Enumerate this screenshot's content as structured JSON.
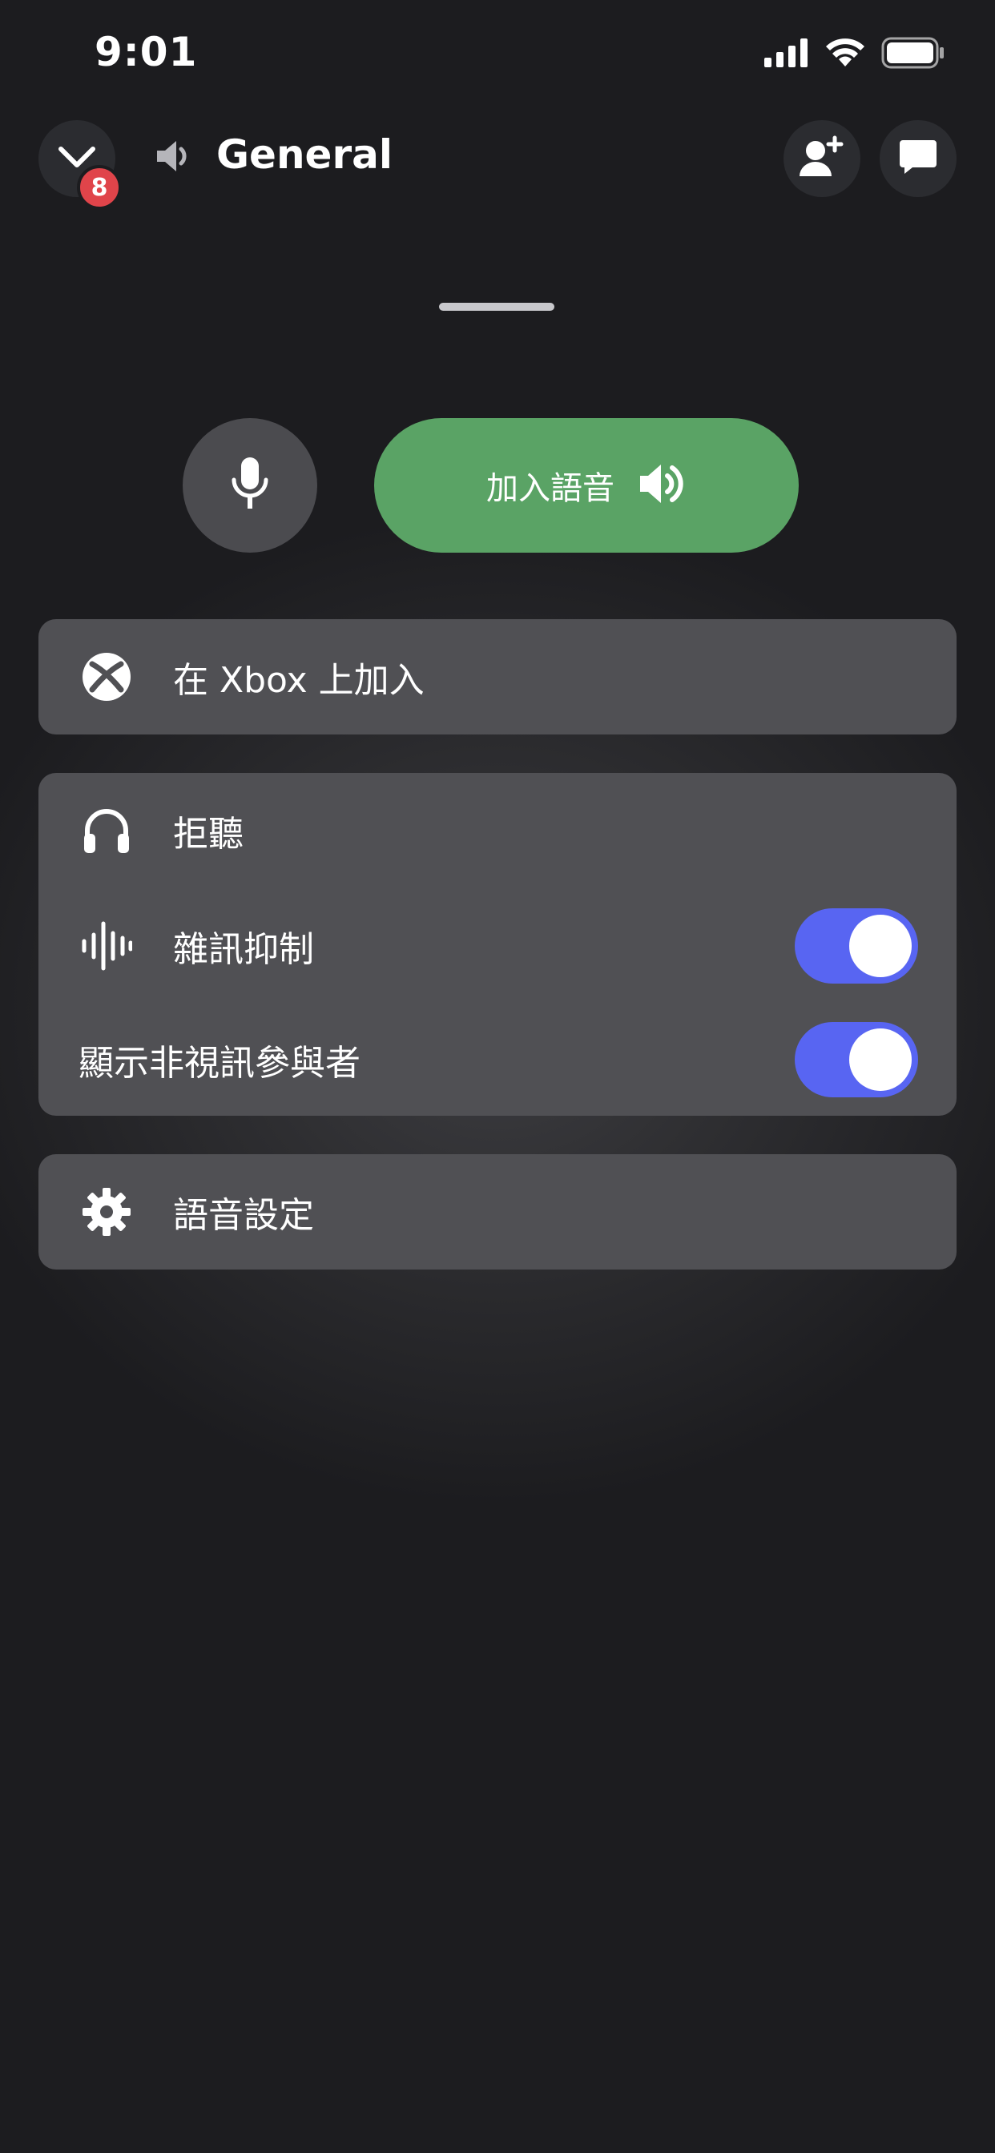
{
  "status_bar": {
    "time": "9:01",
    "icons": [
      "signal-icon",
      "wifi-icon",
      "battery-icon"
    ]
  },
  "header": {
    "badge_count": "8",
    "channel_name": "General",
    "icons": [
      "chevron-down-icon",
      "speaker-icon",
      "add-user-icon",
      "chat-icon"
    ]
  },
  "voice_controls": {
    "join_label": "加入語音"
  },
  "menu": {
    "xbox_label": "在 Xbox 上加入",
    "deafen_label": "拒聽",
    "noise_suppression_label": "雜訊抑制",
    "noise_suppression_on": true,
    "show_non_video_label": "顯示非視訊參與者",
    "show_non_video_on": true,
    "voice_settings_label": "語音設定"
  },
  "colors": {
    "background": "#1c1c1f",
    "join_green": "#5aa365",
    "toggle_blue": "#5865f2",
    "badge_red": "#e0444a",
    "card": "#505054"
  }
}
